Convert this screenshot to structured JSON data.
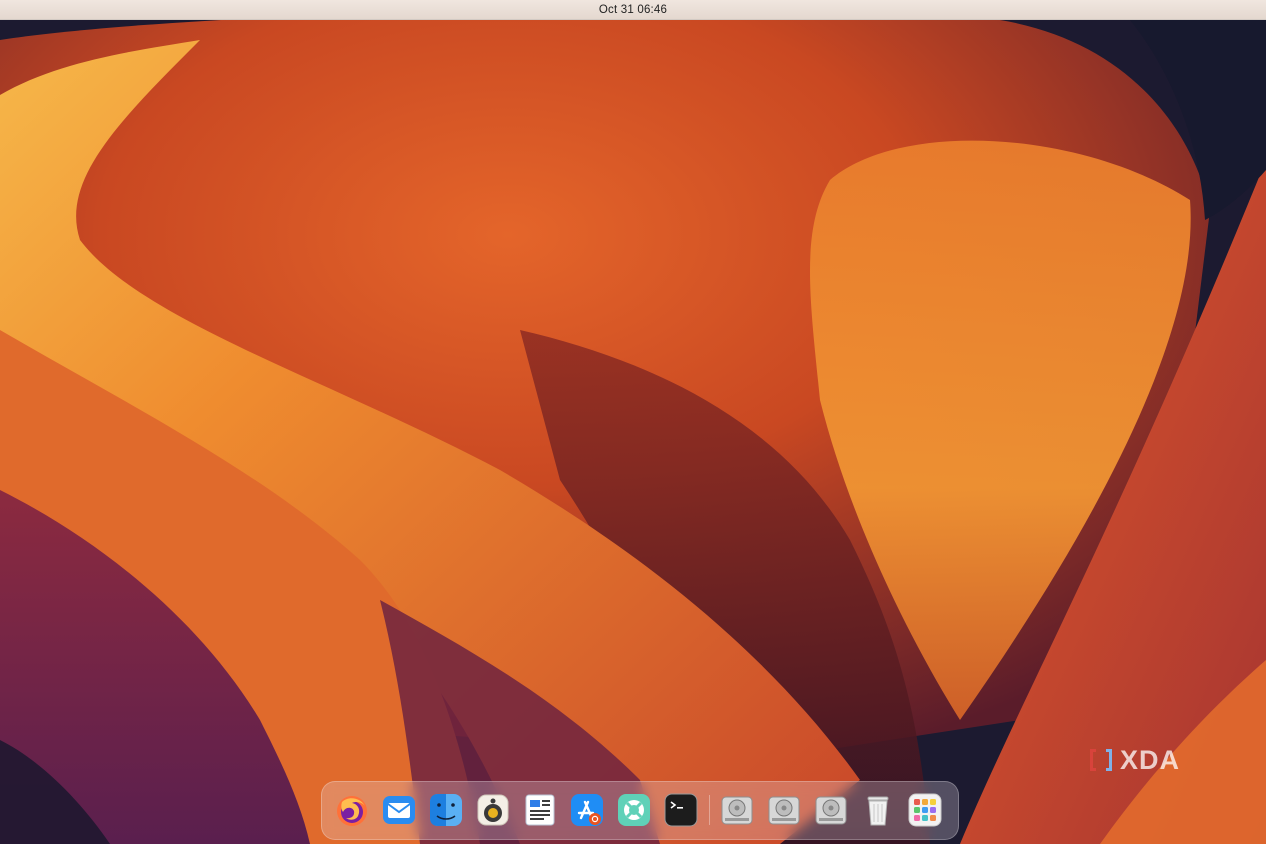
{
  "topbar": {
    "clock": "Oct 31  06:46"
  },
  "watermark": {
    "text": "XDA"
  },
  "dock": {
    "apps": [
      {
        "name": "Firefox",
        "icon": "firefox-icon"
      },
      {
        "name": "Mail",
        "icon": "mail-icon"
      },
      {
        "name": "Finder",
        "icon": "finder-icon"
      },
      {
        "name": "Rhythmbox",
        "icon": "speaker-icon"
      },
      {
        "name": "Text Editor",
        "icon": "document-icon"
      },
      {
        "name": "App Store",
        "icon": "app-store-icon"
      },
      {
        "name": "Help",
        "icon": "help-lifebuoy-icon"
      },
      {
        "name": "Terminal",
        "icon": "terminal-icon"
      }
    ],
    "drives": [
      {
        "name": "Drive 1",
        "icon": "hard-drive-icon"
      },
      {
        "name": "Drive 2",
        "icon": "hard-drive-icon"
      },
      {
        "name": "Drive 3",
        "icon": "hard-drive-icon"
      }
    ],
    "trash": {
      "name": "Trash",
      "icon": "trash-icon"
    },
    "launcher": {
      "name": "Show Applications",
      "icon": "app-grid-icon"
    }
  }
}
